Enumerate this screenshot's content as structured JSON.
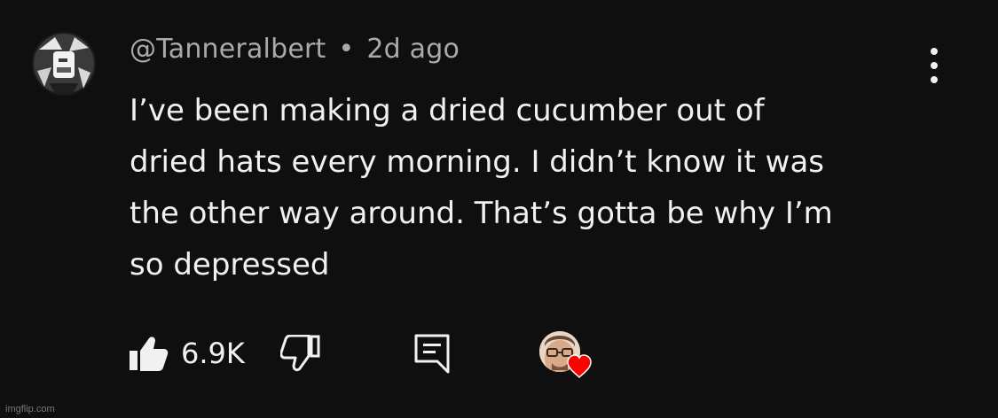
{
  "comment": {
    "author": "@Tanneralbert",
    "separator": "•",
    "timestamp": "2d ago",
    "text_lines": [
      "I’ve been making a dried cucumber out of",
      "dried hats every morning. I didn’t know it was",
      "the other way around. That’s gotta be why I’m",
      "so depressed"
    ],
    "like_count": "6.9K"
  },
  "icons": {
    "more": "more-vertical-icon",
    "like": "thumbs-up-filled-icon",
    "dislike": "thumbs-down-outline-icon",
    "reply": "reply-comment-icon",
    "creator_heart": "heart-icon"
  },
  "colors": {
    "background": "#0f0f0f",
    "primary_text": "#f1f1f1",
    "secondary_text": "#aaaaaa",
    "heart": "#ff0000"
  },
  "watermark": "imgflip.com"
}
